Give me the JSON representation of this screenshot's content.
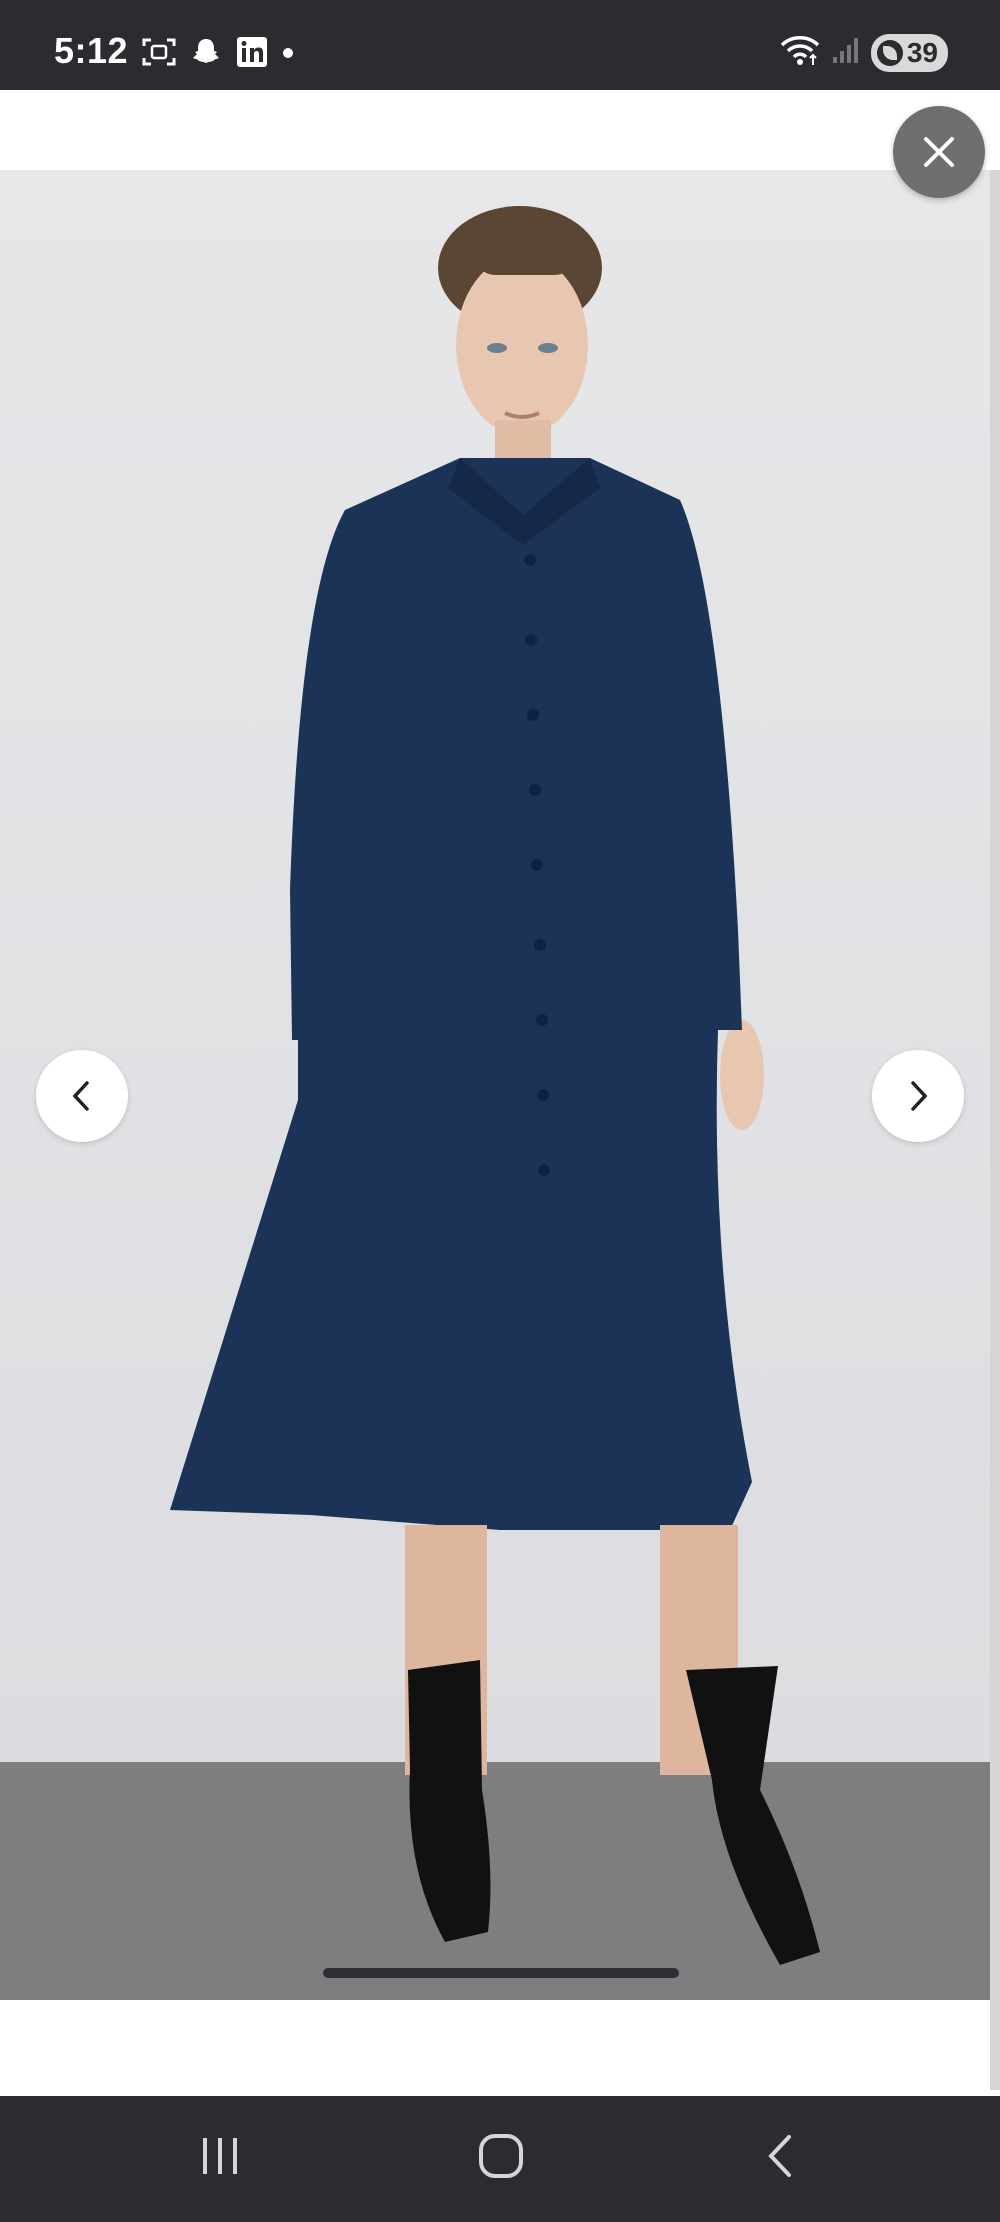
{
  "status_bar": {
    "time": "5:12",
    "left_icons": [
      "screenshot-icon",
      "snapchat-icon",
      "linkedin-icon",
      "dot-icon"
    ],
    "right_icons": [
      "wifi-icon",
      "signal-icon"
    ],
    "battery": "39"
  },
  "viewer": {
    "close_icon": "close-icon",
    "prev_icon": "chevron-left-icon",
    "next_icon": "chevron-right-icon",
    "image_subject": "product-photo",
    "colors": {
      "dress": "#1c3358",
      "background": "#e3e4e6",
      "floor": "#7e7e80",
      "boots": "#111111"
    }
  },
  "system_nav": {
    "buttons": [
      "recents-icon",
      "home-icon",
      "back-icon"
    ]
  }
}
